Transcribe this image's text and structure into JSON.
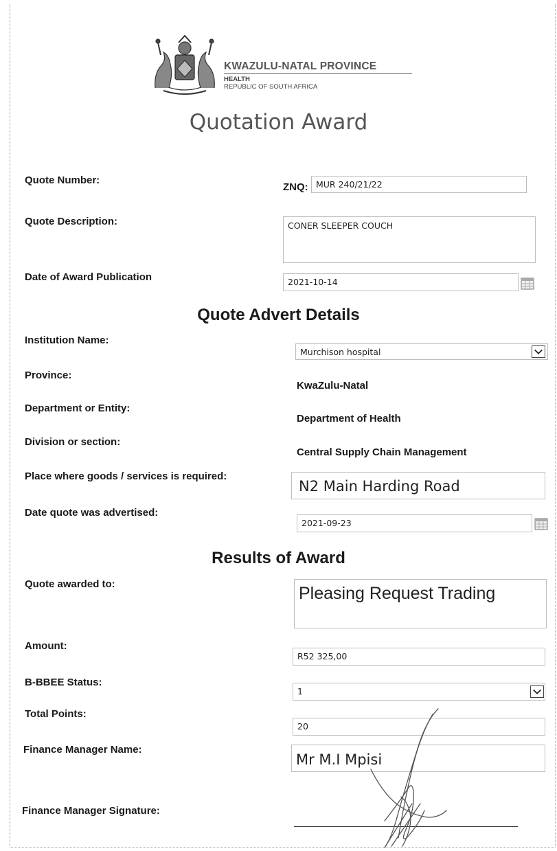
{
  "header": {
    "province": "KWAZULU-NATAL PROVINCE",
    "dept": "HEALTH",
    "country": "REPUBLIC OF SOUTH AFRICA"
  },
  "title": "Quotation Award",
  "quote": {
    "number_label": "Quote Number:",
    "number_prefix": "ZNQ:",
    "number_value": "MUR 240/21/22",
    "description_label": "Quote Description:",
    "description_value": "CONER SLEEPER COUCH",
    "date_award_label": "Date of Award Publication",
    "date_award_value": "2021-10-14"
  },
  "advert": {
    "heading": "Quote Advert Details",
    "institution_label": "Institution Name:",
    "institution_value": "Murchison hospital",
    "province_label": "Province:",
    "province_value": "KwaZulu-Natal",
    "department_label": "Department or Entity:",
    "department_value": "Department of Health",
    "division_label": "Division or section:",
    "division_value": "Central Supply Chain Management",
    "place_label": "Place where goods /  services is required:",
    "place_value": "N2 Main Harding Road",
    "date_adv_label": "Date quote was advertised:",
    "date_adv_value": "2021-09-23"
  },
  "results": {
    "heading": "Results of Award",
    "awarded_label": "Quote awarded to:",
    "awarded_value": "Pleasing Request Trading",
    "amount_label": "Amount:",
    "amount_value": "R52 325,00",
    "bbbee_label": "B-BBEE Status:",
    "bbbee_value": "1",
    "points_label": "Total Points:",
    "points_value": "20",
    "manager_label": "Finance Manager Name:",
    "manager_value": "Mr M.I Mpisi",
    "signature_label": "Finance Manager Signature:"
  },
  "icons": {
    "dropdown": "chevron-down-icon",
    "calendar": "calendar-icon",
    "crest": "coat-of-arms-icon"
  }
}
